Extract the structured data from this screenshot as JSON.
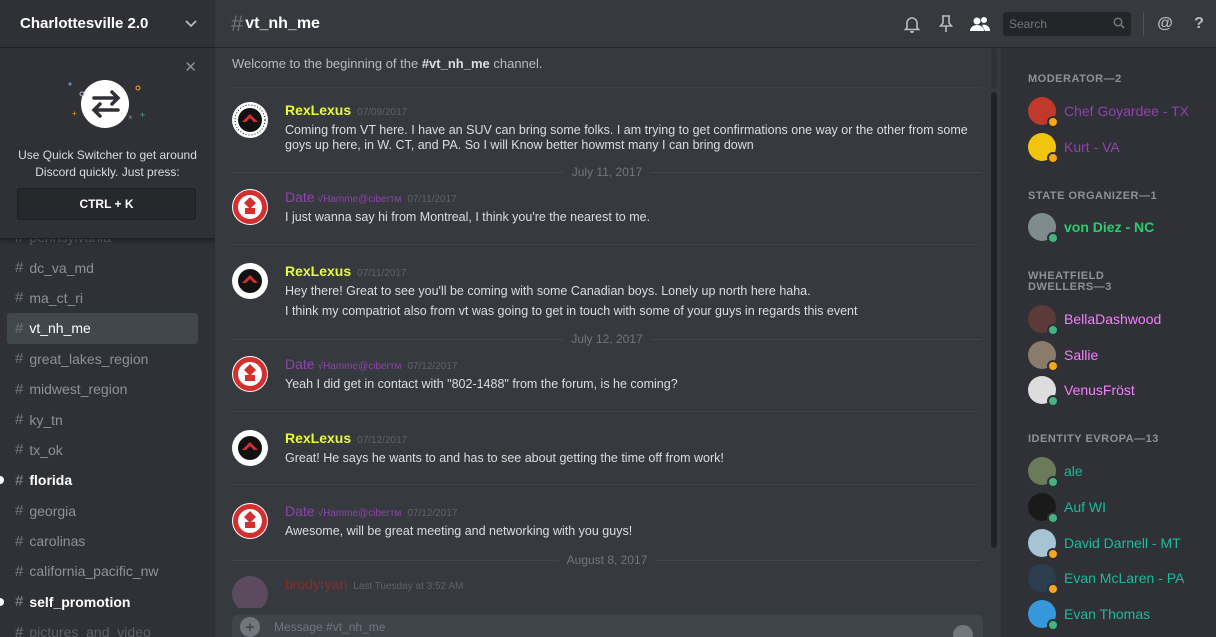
{
  "server": {
    "name": "Charlottesville 2.0"
  },
  "quick_switcher": {
    "text_line1": "Use Quick Switcher to get around",
    "text_line2": "Discord quickly. Just press:",
    "shortcut": "CTRL + K"
  },
  "channels": [
    {
      "name": "pennsylvania",
      "state": "faded"
    },
    {
      "name": "dc_va_md",
      "state": "normal"
    },
    {
      "name": "ma_ct_ri",
      "state": "normal"
    },
    {
      "name": "vt_nh_me",
      "state": "active"
    },
    {
      "name": "great_lakes_region",
      "state": "normal"
    },
    {
      "name": "midwest_region",
      "state": "normal"
    },
    {
      "name": "ky_tn",
      "state": "normal"
    },
    {
      "name": "tx_ok",
      "state": "normal"
    },
    {
      "name": "florida",
      "state": "unread"
    },
    {
      "name": "georgia",
      "state": "normal"
    },
    {
      "name": "carolinas",
      "state": "normal"
    },
    {
      "name": "california_pacific_nw",
      "state": "normal"
    },
    {
      "name": "self_promotion",
      "state": "unread"
    },
    {
      "name": "pictures_and_video",
      "state": "faded"
    }
  ],
  "header": {
    "hash": "#",
    "channel": "vt_nh_me",
    "search_placeholder": "Search",
    "mention": "@",
    "help": "?"
  },
  "welcome": {
    "prefix": "Welcome to the beginning of the ",
    "channel": "#vt_nh_me",
    "suffix": " channel."
  },
  "messages": [
    {
      "author": "RexLexus",
      "time": "07/09/2017",
      "lines": [
        "Coming from VT here. I have an SUV can bring some folks. I am trying to get confirmations one way or the other from some goys up here, in W. CT, and PA. So I will Know better howmst many I can bring down"
      ]
    },
    {
      "author": "Date",
      "badge": "√Hamme@ciberᴛᴍ",
      "time": "07/11/2017",
      "lines": [
        "I just wanna say hi from Montreal, I think you're the nearest to me."
      ]
    },
    {
      "author": "RexLexus",
      "time": "07/11/2017",
      "lines": [
        "Hey there! Great to see you'll be coming with some Canadian boys. Lonely up north here haha.",
        "I think my compatriot also from vt was going to get in touch with some of your guys in regards this event"
      ]
    },
    {
      "author": "Date",
      "badge": "√Hamme@ciberᴛᴍ",
      "time": "07/12/2017",
      "lines": [
        "Yeah I did get in contact with \"802-1488\" from the forum, is he coming?"
      ]
    },
    {
      "author": "RexLexus",
      "time": "07/12/2017",
      "lines": [
        "Great! He says he wants to and has to see about getting the time off from work!"
      ]
    },
    {
      "author": "Date",
      "badge": "√Hamme@ciberᴛᴍ",
      "time": "07/12/2017",
      "lines": [
        "Awesome, will be great meeting and networking with you guys!"
      ]
    },
    {
      "author": "brodyryan",
      "time": "Last Tuesday at 3:52 AM",
      "lines": []
    }
  ],
  "date_separators": [
    "July 11, 2017",
    "July 12, 2017",
    "August 8, 2017"
  ],
  "composer": {
    "placeholder": "Message #vt_nh_me",
    "plus": "+"
  },
  "member_groups": [
    {
      "title": "MODERATOR—2",
      "members": [
        {
          "name": "Chef Goyardee - TX",
          "color": "#8e44ad",
          "status": "idle"
        },
        {
          "name": "Kurt - VA",
          "color": "#8e44ad",
          "status": "idle"
        }
      ]
    },
    {
      "title": "STATE ORGANIZER—1",
      "members": [
        {
          "name": "von Diez - NC",
          "color": "#2ecc71",
          "status": "online"
        }
      ]
    },
    {
      "title_line1": "WHEATFIELD",
      "title_line2": "DWELLERS—3",
      "members": [
        {
          "name": "BellaDashwood",
          "color": "#f47fff",
          "status": "online"
        },
        {
          "name": "Sallie",
          "color": "#f47fff",
          "status": "idle"
        },
        {
          "name": "VenusFröst",
          "color": "#f47fff",
          "status": "online"
        }
      ]
    },
    {
      "title": "IDENTITY EVROPA—13",
      "members": [
        {
          "name": "ale",
          "color": "#1abc9c",
          "status": "online"
        },
        {
          "name": "Auf WI",
          "color": "#1abc9c",
          "status": "online"
        },
        {
          "name": "David Darnell - MT",
          "color": "#1abc9c",
          "status": "idle"
        },
        {
          "name": "Evan McLaren - PA",
          "color": "#1abc9c",
          "status": "idle"
        },
        {
          "name": "Evan Thomas",
          "color": "#1abc9c",
          "status": "online"
        }
      ]
    }
  ],
  "colors": {
    "rex": "#e9f93e",
    "date": "#8e44ad",
    "online": "#43b581",
    "idle": "#faa61a"
  }
}
